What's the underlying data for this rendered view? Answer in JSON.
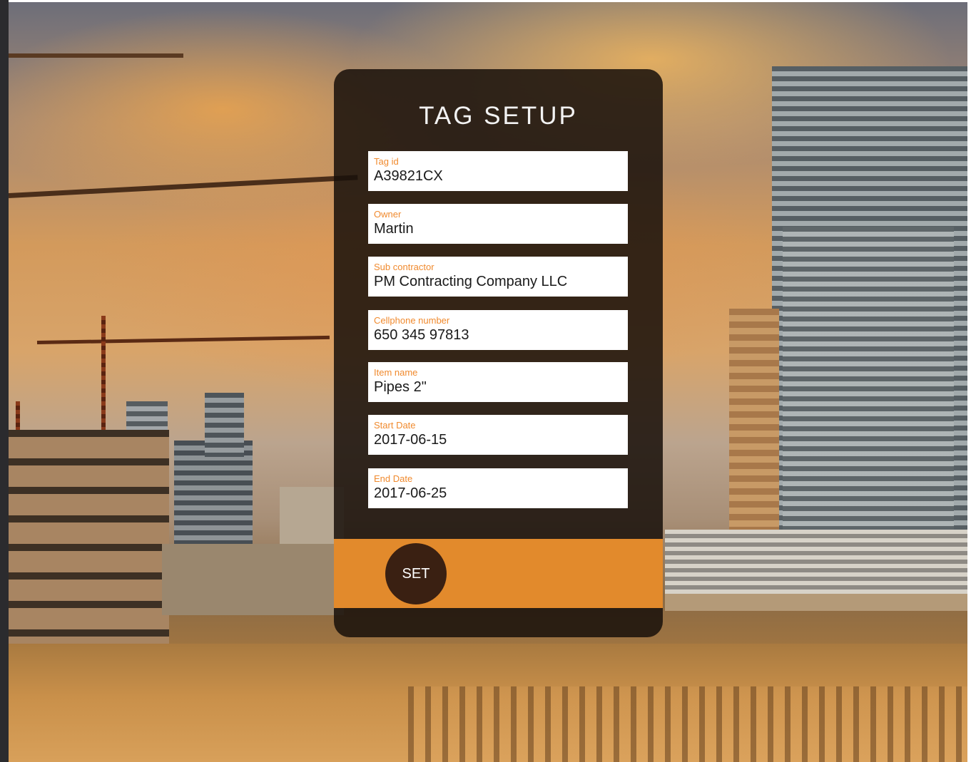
{
  "form": {
    "title": "TAG SETUP",
    "fields": [
      {
        "label": "Tag id",
        "value": "A39821CX"
      },
      {
        "label": "Owner",
        "value": "Martin"
      },
      {
        "label": "Sub contractor",
        "value": "PM Contracting Company LLC"
      },
      {
        "label": "Cellphone number",
        "value": "650 345 97813"
      },
      {
        "label": "Item name",
        "value": "Pipes 2\""
      },
      {
        "label": "Start Date",
        "value": "2017-06-15"
      },
      {
        "label": "End Date",
        "value": "2017-06-25"
      }
    ],
    "set_label": "SET"
  },
  "colors": {
    "accent": "#e28a2c",
    "label": "#f08a2e",
    "panel": "#18100a",
    "button": "#3a2012"
  }
}
